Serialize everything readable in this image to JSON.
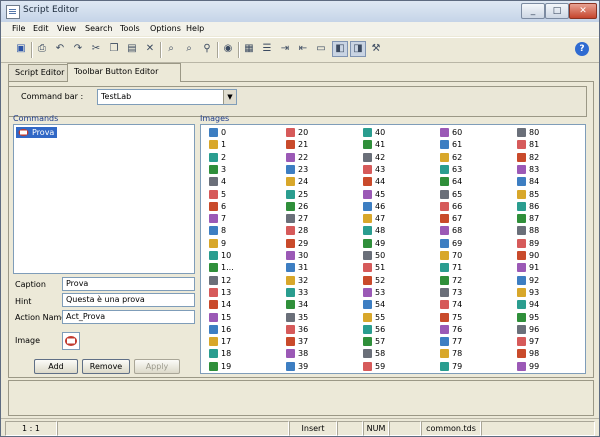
{
  "window": {
    "title": "Script Editor"
  },
  "window_controls": {
    "minimize": "_",
    "maximize": "□",
    "close": "✕"
  },
  "menubar": [
    "File",
    "Edit",
    "View",
    "Search",
    "Tools",
    "Options",
    "Help"
  ],
  "toolbar": {
    "icons": [
      "save-icon",
      "print-icon",
      "undo-icon",
      "redo-icon",
      "cut-icon",
      "copy-icon",
      "paste-icon",
      "delete-icon",
      "find-icon",
      "find-next-icon",
      "replace-icon",
      "goto-icon",
      "browse-icon",
      "list-icon",
      "indent-icon",
      "outdent-icon",
      "toggle-icon",
      "panel-one-icon",
      "panel-two-icon",
      "tools-icon"
    ],
    "help_icon": "help-icon"
  },
  "tabs": [
    {
      "label": "Script Editor",
      "selected": false
    },
    {
      "label": "Toolbar Button Editor",
      "selected": true
    }
  ],
  "command_bar": {
    "label": "Command bar :",
    "value": "TestLab"
  },
  "commands": {
    "header": "Commands",
    "items": [
      {
        "label": "Prova",
        "selected": true
      }
    ]
  },
  "images": {
    "header": "Images",
    "columns": [
      [
        "0",
        "1",
        "2",
        "3",
        "4",
        "5",
        "6",
        "7",
        "8",
        "9",
        "10",
        "1...",
        "12",
        "13",
        "14",
        "15",
        "16",
        "17",
        "18",
        "19"
      ],
      [
        "20",
        "21",
        "22",
        "23",
        "24",
        "25",
        "26",
        "27",
        "28",
        "29",
        "30",
        "31",
        "32",
        "33",
        "34",
        "35",
        "36",
        "37",
        "38",
        "39"
      ],
      [
        "40",
        "41",
        "42",
        "43",
        "44",
        "45",
        "46",
        "47",
        "48",
        "49",
        "50",
        "51",
        "52",
        "53",
        "54",
        "55",
        "56",
        "57",
        "58",
        "59"
      ],
      [
        "60",
        "61",
        "62",
        "63",
        "64",
        "65",
        "66",
        "67",
        "68",
        "69",
        "70",
        "71",
        "72",
        "73",
        "74",
        "75",
        "76",
        "77",
        "78",
        "79"
      ],
      [
        "80",
        "81",
        "82",
        "83",
        "84",
        "85",
        "86",
        "87",
        "88",
        "89",
        "90",
        "91",
        "92",
        "93",
        "94",
        "95",
        "96",
        "97",
        "98",
        "99"
      ]
    ],
    "icon_colors": [
      "#3d7ec2",
      "#2f8f3a",
      "#c94a2b",
      "#d8a72a",
      "#6a6f79",
      "#9b59b6",
      "#2a9d8f",
      "#d65a5a"
    ]
  },
  "fields": {
    "caption": {
      "label": "Caption",
      "value": "Prova"
    },
    "hint": {
      "label": "Hint",
      "value": "Questa è una prova"
    },
    "action_name": {
      "label": "Action Name",
      "value": "Act_Prova"
    },
    "image": {
      "label": "Image"
    }
  },
  "buttons": {
    "add": "Add",
    "remove": "Remove",
    "apply": "Apply"
  },
  "status": {
    "position": "1 : 1",
    "mode": "Insert",
    "num": "NUM",
    "file": "common.tds"
  }
}
